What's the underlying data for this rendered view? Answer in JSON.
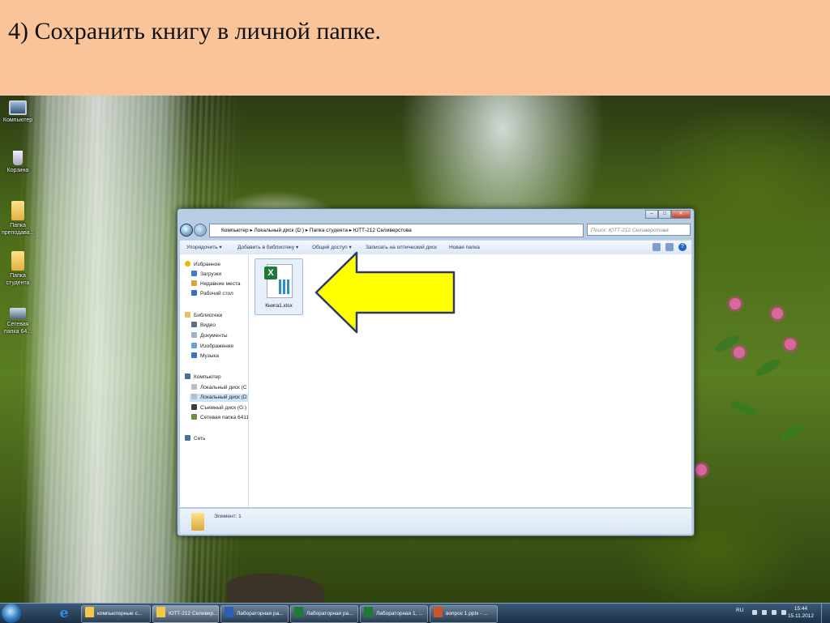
{
  "slide": {
    "title": "4) Сохранить книгу в личной папке."
  },
  "desktop_icons": [
    {
      "label": "Компьютер",
      "icon": "computer-icon"
    },
    {
      "label": "Корзина",
      "icon": "recycle-bin-icon"
    },
    {
      "label": "Папка преподава...",
      "icon": "folder-icon"
    },
    {
      "label": "Папка студента",
      "icon": "folder-icon"
    },
    {
      "label": "Сетевая папка 64...",
      "icon": "network-folder-icon"
    }
  ],
  "explorer": {
    "breadcrumb": [
      "Компьютер",
      "Локальный диск (D:)",
      "Папка студента",
      "ЮТТ-212 Селиверстова"
    ],
    "search_placeholder": "Поиск: ЮТТ-212 Селиверстова",
    "toolbar": {
      "organize": "Упорядочить ▾",
      "add_library": "Добавить в библиотеку ▾",
      "share": "Общий доступ ▾",
      "burn": "Записать на оптический диск",
      "new_folder": "Новая папка"
    },
    "nav": {
      "favorites": "Избранное",
      "downloads": "Загрузки",
      "recent": "Недавние места",
      "desktop": "Рабочий стол",
      "libraries": "Библиотеки",
      "video": "Видео",
      "documents": "Документы",
      "images": "Изображения",
      "music": "Музыка",
      "computer": "Компьютер",
      "disk_c": "Локальный диск (C",
      "disk_d": "Локальный диск (D",
      "removable": "Съемный диск (G:)",
      "net_folder": "Сетевая папка 6411",
      "network": "Сеть"
    },
    "file": {
      "name": "Книга1.xlsx",
      "icon": "excel-file-icon"
    },
    "status": "Элемент: 1"
  },
  "taskbar": {
    "buttons": [
      {
        "label": "компьютерные с...",
        "icon": "folder-icon"
      },
      {
        "label": "ЮТТ-212 Селивер...",
        "icon": "folder-icon"
      },
      {
        "label": "Лабораторная ра...",
        "icon": "word-icon"
      },
      {
        "label": "Лабораторная ра...",
        "icon": "excel-icon"
      },
      {
        "label": "Лабораторная 1, ...",
        "icon": "excel-icon"
      },
      {
        "label": "вопрос 1.pptx - ...",
        "icon": "powerpoint-icon"
      }
    ],
    "lang": "RU",
    "time": "15:44",
    "date": "15.11.2012"
  },
  "colors": {
    "banner": "#f9c49a",
    "arrow_fill": "#ffff00",
    "arrow_stroke": "#2b3a6b"
  }
}
